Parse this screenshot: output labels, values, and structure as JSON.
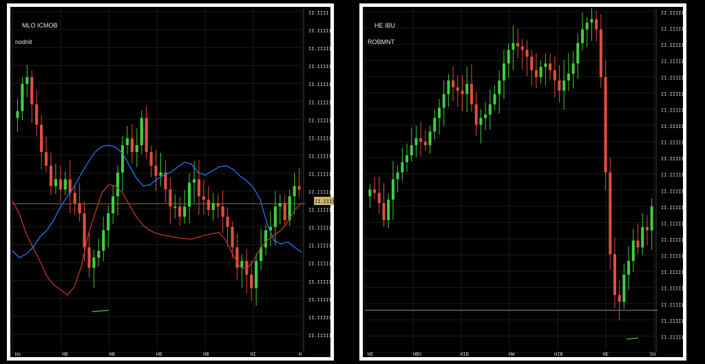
{
  "colors": {
    "background": "#000000",
    "frame": "#ffffff",
    "grid": "#1c1c1c",
    "up_candle": "#3fcf3f",
    "down_candle": "#e0503c",
    "ma_blue": "#1e7bff",
    "ma_red": "#c0392b",
    "level_line_left": "#8a7a3a",
    "level_line_right": "#9a9a8a",
    "axis_text": "#d0d0d0",
    "price_tag": "#c8b46a"
  },
  "chart_data": [
    {
      "type": "candlestick",
      "header_line1": "MLO ICMOB",
      "header_line2": "nodnit",
      "xlabel": "",
      "ylabel": "",
      "x_tick_labels": [
        "Ho",
        "HB",
        "HB",
        "HB",
        "HB",
        "HI",
        "H"
      ],
      "y_tick_labels": [
        "II.IIII",
        "II.IIIII",
        "II.IIIII",
        "II.IIIII",
        "II.IIIII",
        "II.IIIII",
        "II.IIIII",
        "II.IIIII",
        "II.IIIII",
        "II.IIIII",
        "II.IIIII",
        "II.IIIII",
        "II.IIIII",
        "II.IIIII",
        "II.IIIII",
        "II.IIIII",
        "II.IIIII",
        "II.IIIII",
        "II.IIIII"
      ],
      "ylim": [
        0,
        100
      ],
      "current_price_tag": "II.IIIII",
      "current_price_level": 84,
      "grid": true,
      "moving_averages": [
        {
          "color": "ma_blue",
          "values": [
            145,
            135,
            140,
            150,
            165,
            175,
            190,
            210,
            225,
            240,
            258,
            275,
            290,
            298,
            300,
            297,
            288,
            270,
            252,
            240,
            242,
            250,
            256,
            260,
            268,
            275,
            272,
            260,
            256,
            262,
            268,
            270,
            265,
            255,
            248,
            238,
            220,
            185,
            160,
            155,
            158,
            150,
            143
          ]
        },
        {
          "color": "ma_red",
          "values": [
            218,
            200,
            170,
            150,
            130,
            108,
            95,
            88,
            80,
            92,
            122,
            168,
            200,
            230,
            242,
            240,
            230,
            212,
            195,
            182,
            175,
            170,
            168,
            166,
            164,
            163,
            162,
            165,
            168,
            170,
            172,
            160,
            140,
            122,
            118,
            130,
            148,
            160,
            168,
            175,
            188,
            205,
            215
          ]
        }
      ],
      "close_series": [
        350,
        390,
        400,
        360,
        330,
        290,
        270,
        240,
        250,
        235,
        250,
        230,
        215,
        200,
        150,
        120,
        135,
        145,
        175,
        200,
        225,
        260,
        300,
        310,
        290,
        300,
        340,
        290,
        270,
        255,
        260,
        235,
        210,
        210,
        195,
        210,
        245,
        250,
        225,
        220,
        205,
        215,
        210,
        195,
        180,
        150,
        120,
        130,
        110,
        90,
        130,
        150,
        175,
        180,
        210,
        215,
        190,
        225,
        240,
        235
      ]
    },
    {
      "type": "candlestick",
      "header_line1": "HE IBU",
      "header_line2": "ROBMNT",
      "xlabel": "",
      "ylabel": "",
      "x_tick_labels": [
        "HE",
        "HBV",
        "HIB",
        "HW",
        "HIB",
        "HE",
        "SH"
      ],
      "y_tick_labels": [
        "II.IIIIII",
        "II.IIIII",
        "II.IIIII",
        "II.IIIII",
        "II.IIIII",
        "II.IIIII",
        "II.IIIII",
        "II.IIIII",
        "II.IIIII",
        "II.IIIII",
        "II.IIIII",
        "II.IIIII",
        "II.IIIII",
        "II.IIIII",
        "II.IIIII",
        "II.IIIII",
        "II.IIIII",
        "II.IIIII",
        "II.IIIII",
        "II.IIIII",
        "II.IIIII"
      ],
      "ylim": [
        0,
        100
      ],
      "grid": true,
      "close_series": [
        235,
        230,
        215,
        190,
        220,
        250,
        260,
        275,
        285,
        300,
        310,
        305,
        300,
        320,
        340,
        355,
        375,
        395,
        385,
        380,
        375,
        390,
        360,
        330,
        340,
        345,
        360,
        375,
        395,
        420,
        440,
        450,
        445,
        440,
        430,
        410,
        400,
        415,
        420,
        410,
        395,
        380,
        395,
        405,
        420,
        450,
        470,
        480,
        485,
        470,
        400,
        260,
        140,
        80,
        70,
        110,
        130,
        160,
        150,
        180,
        175,
        210
      ]
    }
  ]
}
